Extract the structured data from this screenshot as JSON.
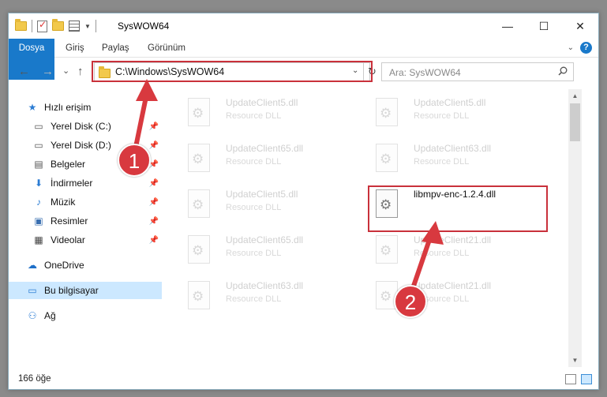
{
  "window": {
    "title": "SysWOW64",
    "controls": {
      "minimize": "—",
      "maximize": "☐",
      "close": "✕"
    }
  },
  "ribbon": {
    "tabs": [
      "Dosya",
      "Giriş",
      "Paylaş",
      "Görünüm"
    ],
    "accent": "#1979ca",
    "help_label": "?"
  },
  "nav": {
    "back": "←",
    "forward": "→",
    "recent": "⌄",
    "up": "↑",
    "address": "C:\\Windows\\SysWOW64",
    "refresh": "↻",
    "search_placeholder": "Ara: SysWOW64"
  },
  "sidebar": {
    "items": [
      {
        "label": "Hızlı erişim",
        "icon": "star-icon",
        "glyph": "★",
        "pinned": false
      },
      {
        "label": "Yerel Disk (C:)",
        "icon": "drive-icon",
        "glyph": "▭",
        "pinned": true
      },
      {
        "label": "Yerel Disk (D:)",
        "icon": "drive-icon",
        "glyph": "▭",
        "pinned": true
      },
      {
        "label": "Belgeler",
        "icon": "documents-icon",
        "glyph": "▤",
        "pinned": true
      },
      {
        "label": "İndirmeler",
        "icon": "download-icon",
        "glyph": "⬇",
        "pinned": true
      },
      {
        "label": "Müzik",
        "icon": "music-icon",
        "glyph": "♪",
        "pinned": true
      },
      {
        "label": "Resimler",
        "icon": "pictures-icon",
        "glyph": "▣",
        "pinned": true
      },
      {
        "label": "Videolar",
        "icon": "video-icon",
        "glyph": "▦",
        "pinned": true
      },
      {
        "label": "OneDrive",
        "icon": "cloud-icon",
        "glyph": "☁",
        "pinned": false
      },
      {
        "label": "Bu bilgisayar",
        "icon": "computer-icon",
        "glyph": "▭",
        "pinned": false
      },
      {
        "label": "Ağ",
        "icon": "network-icon",
        "glyph": "⚇",
        "pinned": false
      }
    ]
  },
  "files": [
    {
      "name": "UpdateClient5.dll",
      "type": "Resource DLL",
      "faded": true
    },
    {
      "name": "UpdateClient5.dll",
      "type": "Resource DLL",
      "faded": true
    },
    {
      "name": "UpdateClient65.dll",
      "type": "Resource DLL",
      "faded": true
    },
    {
      "name": "UpdateClient63.dll",
      "type": "Resource DLL",
      "faded": true
    },
    {
      "name": "UpdateClient5.dll",
      "type": "Resource DLL",
      "faded": true
    },
    {
      "name": "libmpv-enc-1.2.4.dll",
      "type": "",
      "faded": false
    },
    {
      "name": "UpdateClient65.dll",
      "type": "Resource DLL",
      "faded": true
    },
    {
      "name": "UpdateClient21.dll",
      "type": "Resource DLL",
      "faded": true
    },
    {
      "name": "UpdateClient63.dll",
      "type": "Resource DLL",
      "faded": true
    },
    {
      "name": "UpdateClient21.dll",
      "type": "Resource DLL",
      "faded": true
    }
  ],
  "status": {
    "count": "166 öğe"
  },
  "annotations": {
    "badge1": "1",
    "badge2": "2",
    "highlight_color": "#c9313b"
  }
}
